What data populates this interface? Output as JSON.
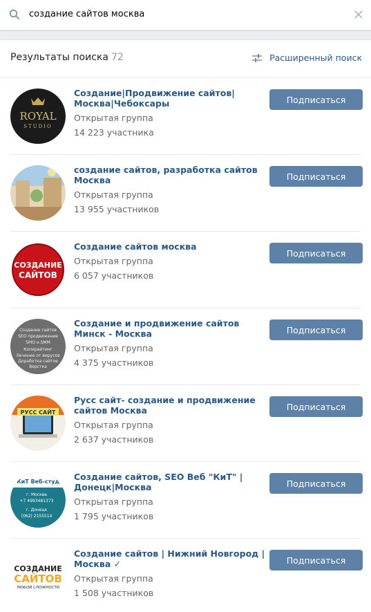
{
  "search": {
    "query": "создание сайтов москва"
  },
  "results_header": {
    "title": "Результаты поиска",
    "count": "72",
    "advanced_label": "Расширенный поиск"
  },
  "groups": [
    {
      "name": "Создание|Продвижение сайтов|Москва|Чебоксары",
      "type": "Открытая группа",
      "members": "14 223 участника",
      "button": "Подписаться",
      "avatar_text": [
        "ROYAL",
        "STUDIO"
      ]
    },
    {
      "name": "создание сайтов, разработка сайтов Москва",
      "type": "Открытая группа",
      "members": "13 955 участников",
      "button": "Подписаться"
    },
    {
      "name": "Создание сайтов москва",
      "type": "Открытая группа",
      "members": "6 057 участников",
      "button": "Подписаться",
      "avatar_text": [
        "СОЗДАНИЕ",
        "САЙТОВ"
      ]
    },
    {
      "name": "Создание и продвижение сайтов Минск - Москва",
      "type": "Открытая группа",
      "members": "4 375 участников",
      "button": "Подписаться",
      "avatar_text": [
        "Создание сайтов",
        "SEO продвижение",
        "SMO и SMM",
        "Копирайтинг",
        "Лечение от вирусов",
        "Доработка сайтов",
        "Верстка"
      ]
    },
    {
      "name": "Русс сайт- создание и продвижение сайтов Москва",
      "type": "Открытая группа",
      "members": "2 637 участников",
      "button": "Подписаться",
      "avatar_text": [
        "РУСС САЙТ"
      ]
    },
    {
      "name": "Создание сайтов, SEO Веб \"КиТ\" |Донецк|Москва",
      "type": "Открытая группа",
      "members": "1 795 участников",
      "button": "Подписаться",
      "avatar_text": [
        "КиТ Веб-студ",
        "г. Москва",
        "+7 4993481373",
        "г. Донецк",
        "(062) 2155514"
      ]
    },
    {
      "name": "Создание сайтов | Нижний Новгород | Москва ✓",
      "type": "Открытая группа",
      "members": "1 508 участников",
      "button": "Подписаться",
      "avatar_text": [
        "СОЗДАНИЕ",
        "САЙТОВ",
        "ЛЮБОЙ СЛОЖНОСТИ"
      ]
    }
  ]
}
